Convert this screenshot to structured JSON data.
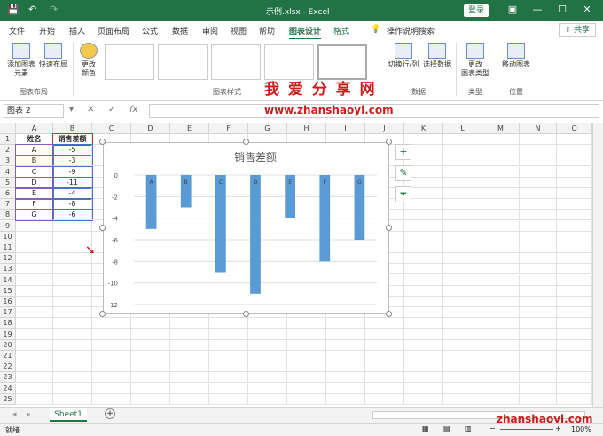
{
  "titlebar": {
    "title": "示例.xlsx  -  Excel",
    "login": "登录",
    "qa_save": "💾",
    "qa_undo": "↶",
    "qa_redo": "↷"
  },
  "tabs": {
    "items": [
      "文件",
      "开始",
      "插入",
      "页面布局",
      "公式",
      "数据",
      "审阅",
      "视图",
      "帮助",
      "图表设计",
      "格式"
    ],
    "active": "图表设计",
    "search": "操作说明搜索",
    "share": "共享"
  },
  "ribbon": {
    "add_element": "添加图表\n元素",
    "quick_layout": "快速布局",
    "change_colors": "更改\n颜色",
    "group_layout": "图表布局",
    "group_styles": "图表样式",
    "switch_row_col": "切换行/列",
    "select_data": "选择数据",
    "group_data": "数据",
    "change_type": "更改\n图表类型",
    "group_type": "类型",
    "move_chart": "移动图表",
    "group_location": "位置"
  },
  "watermark": {
    "cn": "我 爱 分 享 网",
    "url": "www.zhanshaoyi.com",
    "url_bottom": "zhanshaoyi.com"
  },
  "formula_bar": {
    "name_box": "图表 2",
    "fx": "fx",
    "cancel": "✕",
    "confirm": "✓",
    "value": ""
  },
  "sheet": {
    "columns": [
      "A",
      "B",
      "C",
      "D",
      "E",
      "F",
      "G",
      "H",
      "I",
      "J",
      "K",
      "L",
      "M",
      "N",
      "O"
    ],
    "rows": [
      "1",
      "2",
      "3",
      "4",
      "5",
      "6",
      "7",
      "8",
      "9",
      "10",
      "11",
      "12",
      "13",
      "14",
      "15",
      "16",
      "17",
      "18",
      "19",
      "20",
      "21",
      "22",
      "23",
      "24",
      "25"
    ],
    "header": [
      "姓名",
      "销售差额"
    ],
    "data": [
      [
        "A",
        "-5"
      ],
      [
        "B",
        "-3"
      ],
      [
        "C",
        "-9"
      ],
      [
        "D",
        "-11"
      ],
      [
        "E",
        "-4"
      ],
      [
        "F",
        "-8"
      ],
      [
        "G",
        "-6"
      ]
    ]
  },
  "chart_data": {
    "type": "bar",
    "title": "销售差额",
    "categories": [
      "A",
      "B",
      "C",
      "D",
      "E",
      "F",
      "G"
    ],
    "values": [
      -5,
      -3,
      -9,
      -11,
      -4,
      -8,
      -6
    ],
    "yticks": [
      "0",
      "-2",
      "-4",
      "-6",
      "-8",
      "-10",
      "-12"
    ],
    "ylim": [
      -12,
      0
    ],
    "bar_color": "#5b9bd5",
    "grid": true,
    "legend": "none"
  },
  "sheet_tabs": {
    "active": "Sheet1",
    "add": "+"
  },
  "status": {
    "ready": "就绪",
    "zoom": "100%"
  },
  "colors": {
    "excel_green": "#217346",
    "watermark_red": "#d11b1b"
  }
}
